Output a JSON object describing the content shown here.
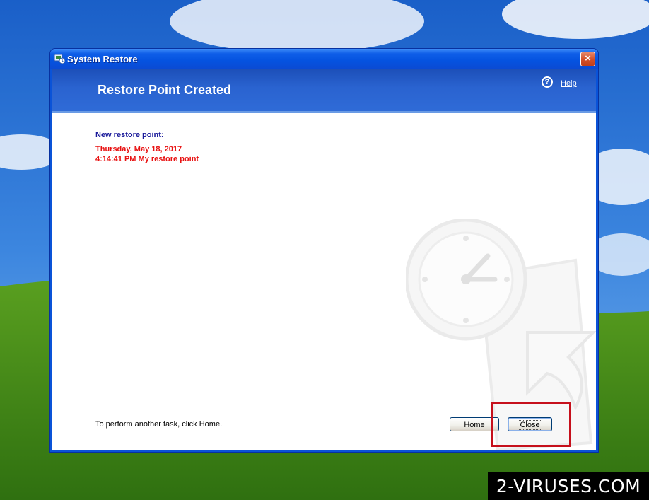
{
  "window": {
    "title": "System Restore",
    "close_glyph": "×"
  },
  "header": {
    "title": "Restore Point Created",
    "help_icon_glyph": "?",
    "help_label": "Help"
  },
  "content": {
    "new_point_label": "New restore point:",
    "date": "Thursday, May 18, 2017",
    "time_and_name": "4:14:41 PM  My restore point",
    "footer_text": "To perform another task, click Home."
  },
  "buttons": {
    "home_label": "Home",
    "close_label": "Close"
  },
  "watermark": {
    "text": "2-VIRUSES.COM"
  },
  "colors": {
    "titlebar_blue": "#0553e0",
    "header_blue": "#2a63d0",
    "label_navy": "#1a1a9a",
    "restore_red": "#e81010",
    "highlight_red": "#c6101c"
  },
  "icons": {
    "app": "system-restore-icon",
    "close": "close-icon",
    "help": "help-icon",
    "background": "clock-restore-watermark-icon"
  }
}
